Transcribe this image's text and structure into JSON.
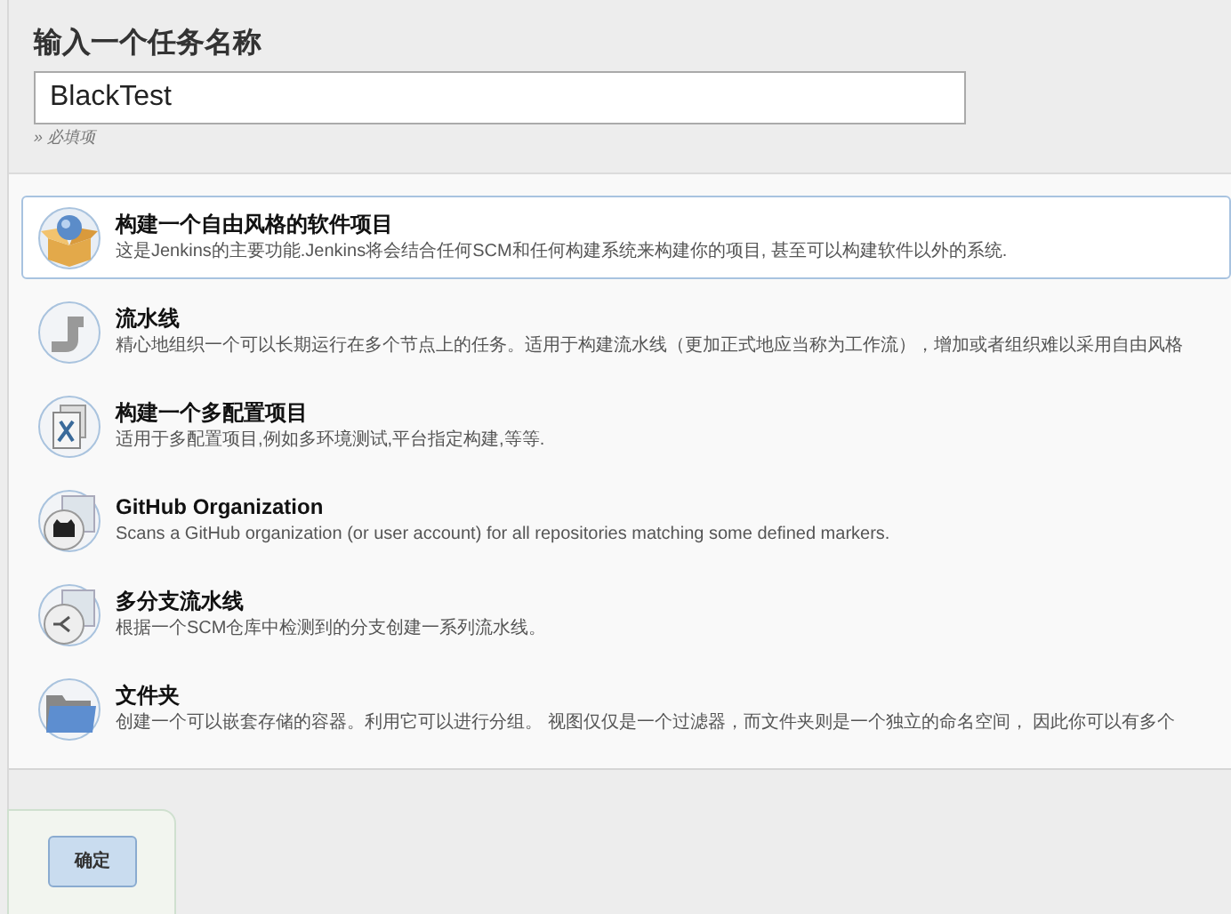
{
  "header": {
    "title": "输入一个任务名称",
    "name_field": {
      "value": "BlackTest"
    },
    "hint": "» 必填项"
  },
  "items": [
    {
      "kind": "freestyle",
      "title": "构建一个自由风格的软件项目",
      "description": "这是Jenkins的主要功能.Jenkins将会结合任何SCM和任何构建系统来构建你的项目, 甚至可以构建软件以外的系统.",
      "selected": true
    },
    {
      "kind": "pipeline",
      "title": "流水线",
      "description": "精心地组织一个可以长期运行在多个节点上的任务。适用于构建流水线（更加正式地应当称为工作流），增加或者组织难以采用自由风格",
      "selected": false
    },
    {
      "kind": "matrix",
      "title": "构建一个多配置项目",
      "description": "适用于多配置项目,例如多环境测试,平台指定构建,等等.",
      "selected": false
    },
    {
      "kind": "github",
      "title": "GitHub Organization",
      "description": "Scans a GitHub organization (or user account) for all repositories matching some defined markers.",
      "selected": false
    },
    {
      "kind": "multibranch",
      "title": "多分支流水线",
      "description": "根据一个SCM仓库中检测到的分支创建一系列流水线。",
      "selected": false
    },
    {
      "kind": "folder",
      "title": "文件夹",
      "description": "创建一个可以嵌套存储的容器。利用它可以进行分组。 视图仅仅是一个过滤器，而文件夹则是一个独立的命名空间， 因此你可以有多个",
      "selected": false
    }
  ],
  "ok_button": "确定"
}
